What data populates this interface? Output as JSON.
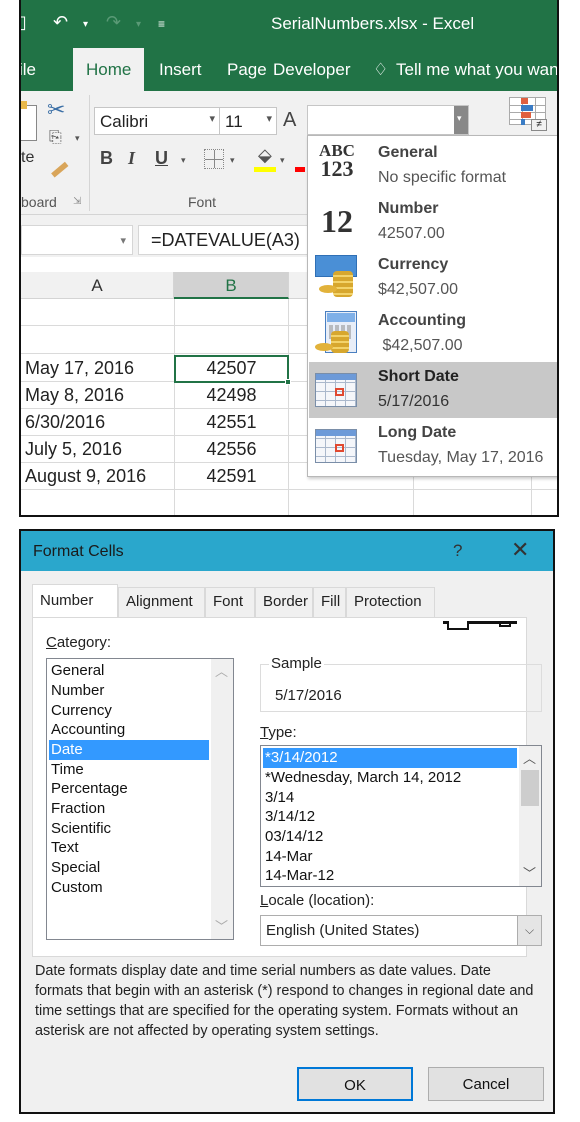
{
  "excel": {
    "title": "SerialNumbers.xlsx - Excel",
    "quick_access": {
      "save_icon": "save-icon",
      "undo_icon": "undo-icon",
      "redo_icon": "redo-icon",
      "customize_icon": "customize-qat-icon"
    },
    "ribbon_tabs": [
      {
        "label": "ile"
      },
      {
        "label": "Home",
        "active": true
      },
      {
        "label": "Insert"
      },
      {
        "label": "Page"
      },
      {
        "label": "Developer"
      }
    ],
    "tell_me": "Tell me what you want",
    "clipboard": {
      "paste_label": "te",
      "group_label": "board"
    },
    "font": {
      "font_name": "Calibri",
      "font_size": "11",
      "group_label": "Font",
      "bold": "B",
      "italic": "I",
      "underline": "U",
      "grow_font": "A"
    },
    "number_format_value": "",
    "name_box": "",
    "formula": "=DATEVALUE(A3)",
    "columns": [
      "A",
      "B"
    ],
    "selected_column": "B",
    "rows": [
      {
        "a": "",
        "b": ""
      },
      {
        "a": "",
        "b": ""
      },
      {
        "a": "May 17, 2016",
        "b": "42507"
      },
      {
        "a": "May 8, 2016",
        "b": "42498"
      },
      {
        "a": "6/30/2016",
        "b": "42551"
      },
      {
        "a": "July 5, 2016",
        "b": "42556"
      },
      {
        "a": "August 9, 2016",
        "b": "42591"
      },
      {
        "a": "",
        "b": ""
      }
    ],
    "number_format_menu": [
      {
        "label": "General",
        "sample": "No specific format",
        "icon": "abc-123-icon"
      },
      {
        "label": "Number",
        "sample": "42507.00",
        "icon": "number-12-icon"
      },
      {
        "label": "Currency",
        "sample": "$42,507.00",
        "icon": "currency-icon"
      },
      {
        "label": "Accounting",
        "sample": " $42,507.00",
        "icon": "accounting-icon"
      },
      {
        "label": "Short Date",
        "sample": "5/17/2016",
        "icon": "calendar-icon",
        "selected": true
      },
      {
        "label": "Long Date",
        "sample": "Tuesday, May 17, 2016",
        "icon": "calendar-icon"
      }
    ]
  },
  "dialog": {
    "title": "Format Cells",
    "help": "?",
    "close": "✕",
    "tabs": [
      {
        "label": "Number",
        "active": true
      },
      {
        "label": "Alignment"
      },
      {
        "label": "Font"
      },
      {
        "label": "Border"
      },
      {
        "label": "Fill"
      },
      {
        "label": "Protection"
      }
    ],
    "category_label_first": "C",
    "category_label_rest": "ategory:",
    "categories": [
      "General",
      "Number",
      "Currency",
      "Accounting",
      "Date",
      "Time",
      "Percentage",
      "Fraction",
      "Scientific",
      "Text",
      "Special",
      "Custom"
    ],
    "selected_category": "Date",
    "sample_label": "Sample",
    "sample_value": "5/17/2016",
    "type_label_first": "T",
    "type_label_rest": "ype:",
    "types": [
      "*3/14/2012",
      "*Wednesday, March 14, 2012",
      "3/14",
      "3/14/12",
      "03/14/12",
      "14-Mar",
      "14-Mar-12"
    ],
    "selected_type": "*3/14/2012",
    "locale_label_first": "L",
    "locale_label_rest": "ocale (location):",
    "locale_value": "English (United States)",
    "description": "Date formats display date and time serial numbers as date values.  Date formats that begin with an asterisk (*) respond to changes in regional date and time settings that are specified for the operating system. Formats without an asterisk are not affected by operating system settings.",
    "ok_label": "OK",
    "cancel_label": "Cancel"
  },
  "colors": {
    "excel_green": "#217346",
    "dialog_title": "#2aa7cc",
    "selection_blue": "#3399ff"
  }
}
